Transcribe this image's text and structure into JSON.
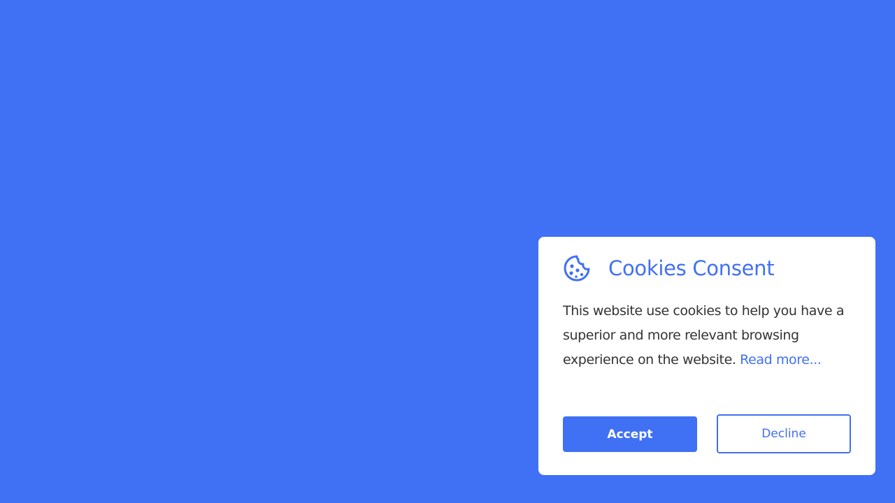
{
  "colors": {
    "background": "#4070f4",
    "accent": "#4070f4",
    "card": "#ffffff",
    "text": "#333333"
  },
  "consent": {
    "icon": "cookie-icon",
    "title": "Cookies Consent",
    "message": "This website use cookies to help you have a superior and more relevant browsing experience on the website.",
    "read_more": "Read more...",
    "accept_label": "Accept",
    "decline_label": "Decline"
  }
}
